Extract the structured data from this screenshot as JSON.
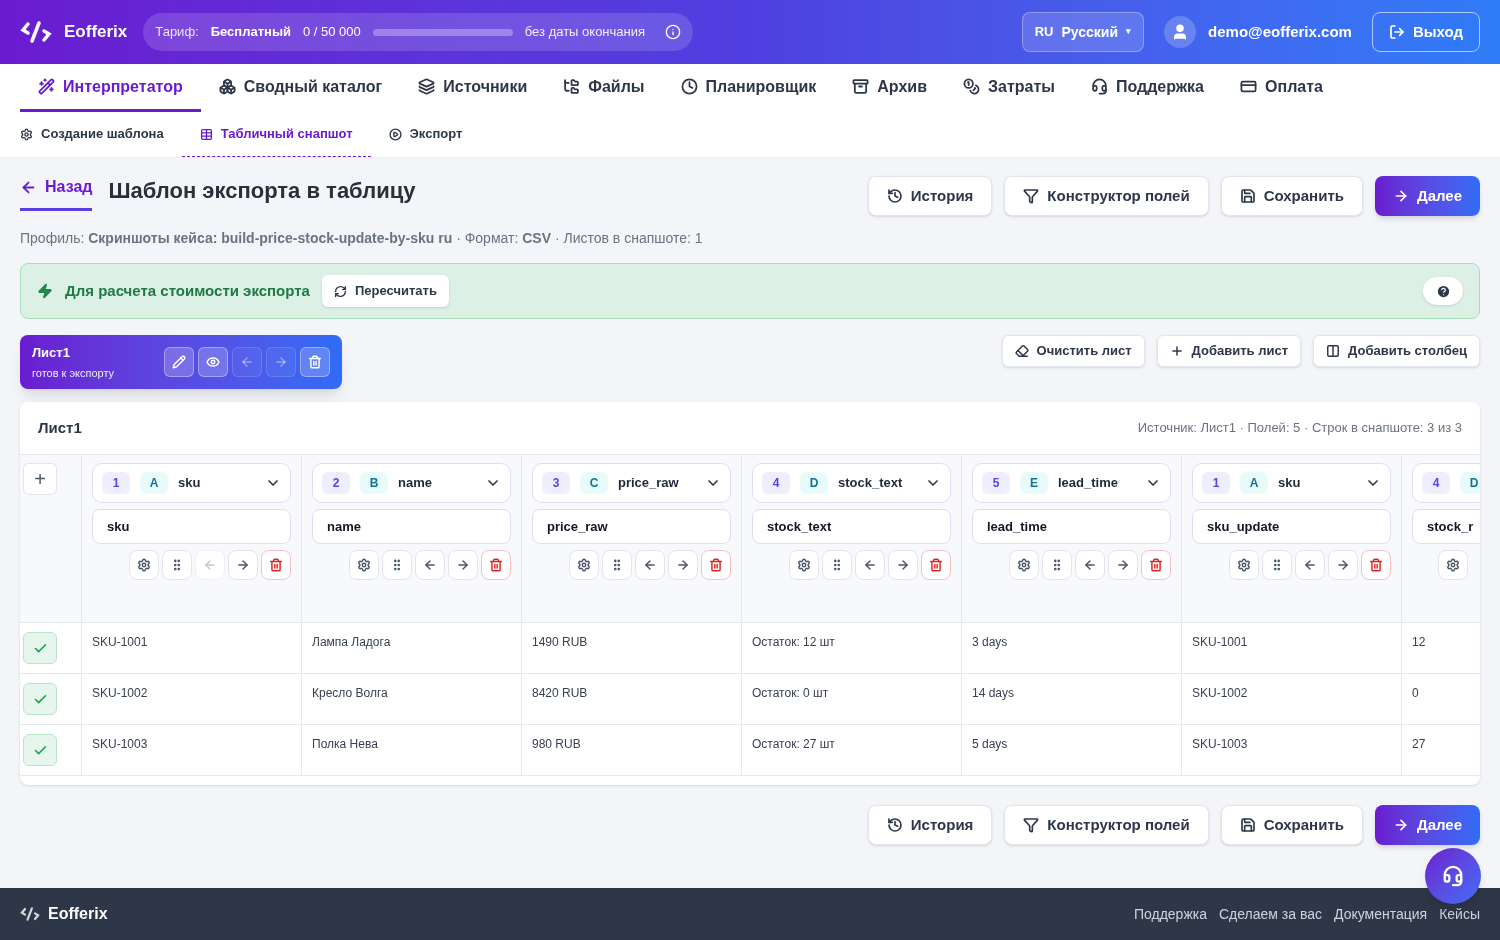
{
  "header": {
    "brand": "Eofferix",
    "tariff": {
      "label": "Тариф:",
      "plan": "Бесплатный",
      "usage": "0 / 50 000",
      "level": 0,
      "expiry": "без даты окончания"
    },
    "language": {
      "code": "RU",
      "name": "Русский",
      "caret": "▾"
    },
    "user": "demo@eofferix.com",
    "logout": "Выход"
  },
  "nav": [
    {
      "label": "Интерпретатор",
      "selected": true
    },
    {
      "label": "Сводный каталог",
      "selected": false
    },
    {
      "label": "Источники",
      "selected": false
    },
    {
      "label": "Файлы",
      "selected": false
    },
    {
      "label": "Планировщик",
      "selected": false
    },
    {
      "label": "Архив",
      "selected": false
    },
    {
      "label": "Затраты",
      "selected": false
    },
    {
      "label": "Поддержка",
      "selected": false
    },
    {
      "label": "Оплата",
      "selected": false
    }
  ],
  "subnav": [
    {
      "label": "Создание шаблона",
      "selected": false
    },
    {
      "label": "Табличный снапшот",
      "selected": true
    },
    {
      "label": "Экспорт",
      "selected": false
    }
  ],
  "page": {
    "back": "Назад",
    "title": "Шаблон экспорта в таблицу",
    "profile": "Профиль: **Скриншоты кейса: build-price-stock-update-by-sku ru** · Формат: **CSV** · Листов в снапшоте: 1"
  },
  "actions": [
    {
      "kind": "history",
      "label": "История"
    },
    {
      "kind": "builder",
      "label": "Конструктор полей"
    },
    {
      "kind": "save",
      "label": "Сохранить"
    },
    {
      "kind": "next",
      "label": "Далее"
    }
  ],
  "banner": {
    "text": "Для расчета стоимости экспорта",
    "button": "Пересчитать"
  },
  "sheet": {
    "name": "Лист1",
    "status": "готов к экспорту",
    "tools": [
      {
        "disabled": false
      },
      {
        "disabled": false
      },
      {
        "disabled": true
      },
      {
        "disabled": true
      },
      {
        "disabled": false
      }
    ]
  },
  "sheet_actions": [
    "Очистить лист",
    "Добавить лист",
    "Добавить столбец"
  ],
  "table": {
    "title": "Лист1",
    "meta": "Источник: Лист1 · Полей: 5 · Строк в снапшоте: 3 из 3",
    "add": "+",
    "columns": [
      {
        "num": "1",
        "letter": "A",
        "source": "sku",
        "field": "sku",
        "left_disabled": true
      },
      {
        "num": "2",
        "letter": "B",
        "source": "name",
        "field": "name",
        "left_disabled": false
      },
      {
        "num": "3",
        "letter": "C",
        "source": "price_raw",
        "field": "price_raw",
        "left_disabled": false
      },
      {
        "num": "4",
        "letter": "D",
        "source": "stock_text",
        "field": "stock_text",
        "left_disabled": false
      },
      {
        "num": "5",
        "letter": "E",
        "source": "lead_time",
        "field": "lead_time",
        "left_disabled": false
      },
      {
        "num": "1",
        "letter": "A",
        "source": "sku",
        "field": "sku_update",
        "left_disabled": false
      },
      {
        "num": "4",
        "letter": "D",
        "field": "stock_r",
        "partial": true
      }
    ],
    "rows": [
      {
        "checked": true,
        "cells": [
          "SKU-1001",
          "Лампа Ладога",
          "1490 RUB",
          "Остаток: 12 шт",
          "3 days",
          "SKU-1001",
          "12"
        ]
      },
      {
        "checked": true,
        "cells": [
          "SKU-1002",
          "Кресло Волга",
          "8420 RUB",
          "Остаток: 0 шт",
          "14 days",
          "SKU-1002",
          "0"
        ]
      },
      {
        "checked": true,
        "cells": [
          "SKU-1003",
          "Полка Нева",
          "980 RUB",
          "Остаток: 27 шт",
          "5 days",
          "SKU-1003",
          "27"
        ]
      }
    ]
  },
  "bottom_actions": [
    {
      "kind": "history",
      "label": "История"
    },
    {
      "kind": "builder",
      "label": "Конструктор полей"
    },
    {
      "kind": "save",
      "label": "Сохранить"
    },
    {
      "kind": "next",
      "label": "Далее"
    }
  ],
  "footer": {
    "brand": "Eofferix",
    "links": [
      "Поддержка",
      "Сделаем за вас",
      "Документация",
      "Кейсы"
    ]
  }
}
